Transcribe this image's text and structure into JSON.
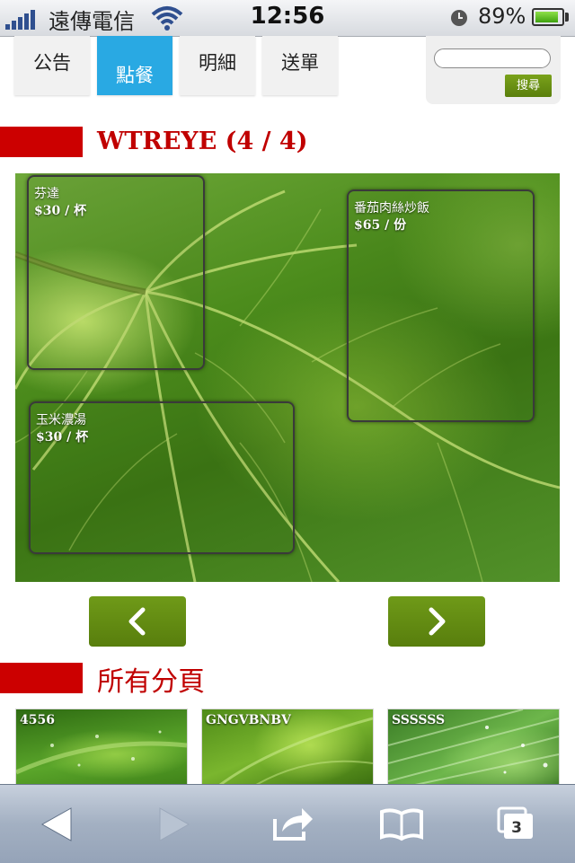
{
  "status_bar": {
    "carrier": "遠傳電信",
    "time": "12:56",
    "battery_percent": "89%",
    "battery_level": 0.89,
    "icons": [
      "signal-icon",
      "wifi-icon",
      "alarm-icon",
      "battery-icon"
    ]
  },
  "tabs": [
    {
      "label": "公告",
      "active": false
    },
    {
      "label": "點餐",
      "active": true
    },
    {
      "label": "明細",
      "active": false
    },
    {
      "label": "送單",
      "active": false
    }
  ],
  "search": {
    "value": "",
    "placeholder": "",
    "button_label": "搜尋"
  },
  "page": {
    "title": "WTREYE (4 / 4)"
  },
  "menu_items": [
    {
      "name": "芬達",
      "price": "$30 / 杯"
    },
    {
      "name": "番茄肉絲炒飯",
      "price": "$65 / 份"
    },
    {
      "name": "玉米濃湯",
      "price": "$30 / 杯"
    }
  ],
  "navigation": {
    "prev_icon": "chevron-left-icon",
    "next_icon": "chevron-right-icon"
  },
  "all_pages": {
    "title": "所有分頁",
    "thumbnails": [
      {
        "label": "4556"
      },
      {
        "label": "GNGVBNBV"
      },
      {
        "label": "SSSSSS"
      }
    ]
  },
  "toolbar": {
    "icons": [
      "back-arrow-icon",
      "forward-arrow-icon",
      "share-icon",
      "bookmarks-icon",
      "tabs-icon"
    ],
    "tab_count": "3"
  },
  "colors": {
    "accent_red": "#cc0000",
    "tab_active": "#29a9e3",
    "button_green": "#6f9a18"
  }
}
